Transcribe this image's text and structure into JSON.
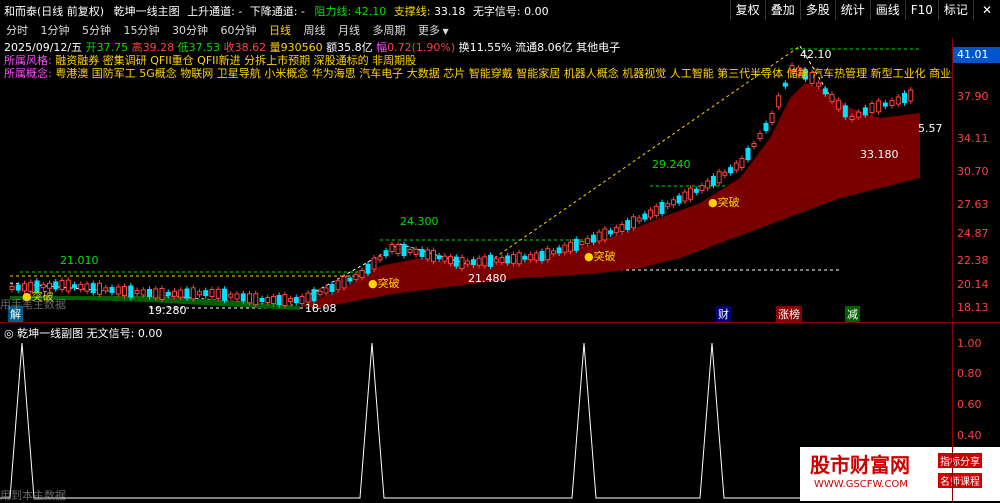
{
  "top_bar": {
    "title": "和而泰(日线 前复权)",
    "indicator_name": "乾坤一线主图",
    "upper_channel_label": "上升通道:",
    "upper_channel_value": "-",
    "lower_channel_label": "下降通道:",
    "lower_channel_value": "-",
    "resistance_label": "阻力线:",
    "resistance_value": "42.10",
    "support_label": "支撑线:",
    "support_value": "33.18",
    "signal_label": "无字信号:",
    "signal_value": "0.00",
    "buttons": [
      "复权",
      "叠加",
      "多股",
      "统计",
      "画线",
      "F10",
      "标记"
    ],
    "close_symbol": "✕"
  },
  "period_bar": {
    "items": [
      "分时",
      "1分钟",
      "5分钟",
      "15分钟",
      "30分钟",
      "60分钟",
      "日线",
      "周线",
      "月线",
      "多周期",
      "更多"
    ],
    "active": "日线"
  },
  "info_bar": {
    "date": "2025/09/12/五",
    "open_label": "开",
    "open": "37.75",
    "high_label": "高",
    "high": "39.28",
    "low_label": "低",
    "low": "37.53",
    "close_label": "收",
    "close": "38.62",
    "volume_label": "量",
    "volume": "930560",
    "amount_label": "额",
    "amount": "35.8亿",
    "change_label": "幅",
    "change": "0.72(1.90%)",
    "turnover_label": "换",
    "turnover": "11.55%",
    "float_label": "流通",
    "float_value": "8.06亿",
    "sector": "其他电子"
  },
  "style_line": {
    "label": "所属风格:",
    "text": "融资融券 密集调研 QFII重仓 QFII新进 分拆上市预期 深股通标的 非周期股"
  },
  "concept_line": {
    "label": "所属概念:",
    "text": "粤港澳 国防军工 5G概念 物联网 卫星导航 小米概念 华为海思 汽车电子 大数据 芯片 智能穿戴 智能家居 机器人概念 机器视觉 人工智能 第三代半导体 储能 汽车热管理 新型工业化 商业航天 AI"
  },
  "main_chart": {
    "price_labels": [
      "21.010",
      "24.300",
      "21.480",
      "29.240",
      "42.10",
      "33.180",
      "19.280",
      "18.08"
    ],
    "breakout_labels": [
      "突破",
      "突破",
      "突破",
      "突破",
      "突破"
    ],
    "marker_labels": [
      "解",
      "财",
      "涨榜",
      "减"
    ],
    "watermark": "用手笔主数据",
    "current_price_tag": "41.01",
    "side_value": "5.57"
  },
  "y_axis": [
    "41.01",
    "37.90",
    "34.11",
    "30.70",
    "27.63",
    "24.87",
    "22.38",
    "20.14",
    "18.13"
  ],
  "sub_chart": {
    "title": "乾坤一线副图",
    "signal_label": "无文信号:",
    "signal_value": "0.00",
    "watermark": "用到本主数据",
    "y_axis": [
      "1.00",
      "0.80",
      "0.60",
      "0.40",
      "0.20",
      "0.00"
    ]
  },
  "watermark_logo": {
    "name": "股市财富网",
    "url": "WWW.GSCFW.COM",
    "tag1": "指标分享",
    "tag2": "名师课程"
  },
  "colors": {
    "up": "#ff4040",
    "down": "#00e0ff",
    "fill": "#7a0000",
    "yellow": "#ffd400"
  }
}
